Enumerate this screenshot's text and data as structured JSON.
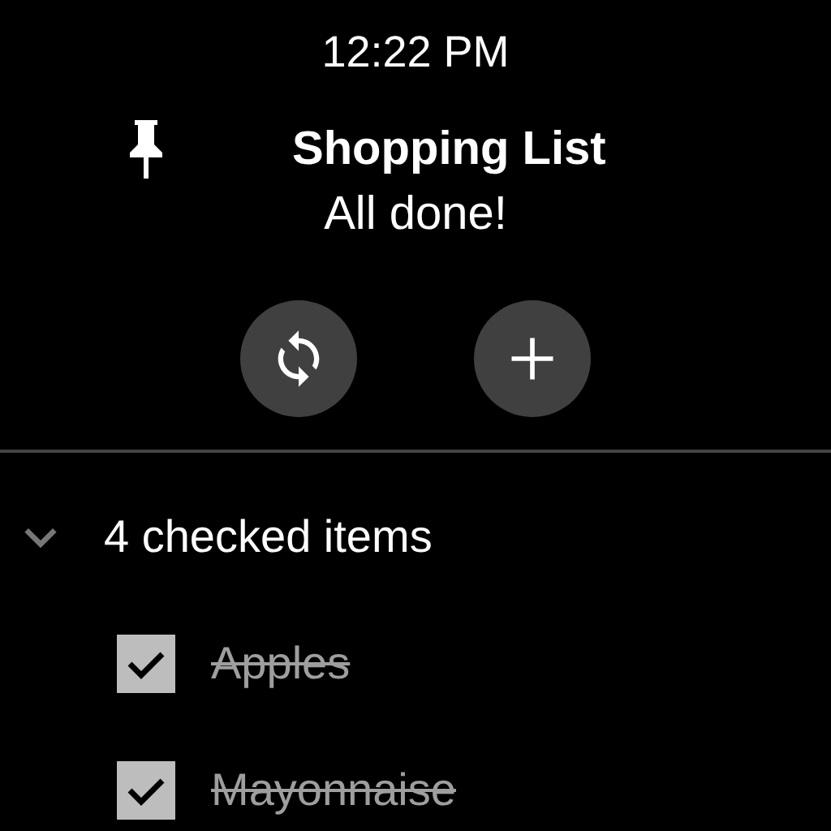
{
  "status_bar": {
    "time": "12:22 PM"
  },
  "note": {
    "pinned": true,
    "title": "Shopping List",
    "subtitle": "All done!"
  },
  "actions": [
    {
      "kind": "refresh"
    },
    {
      "kind": "add"
    }
  ],
  "checked_section": {
    "label": "4 checked items",
    "expanded": true,
    "items": [
      {
        "text": "Apples",
        "checked": true
      },
      {
        "text": "Mayonnaise",
        "checked": true
      }
    ]
  }
}
